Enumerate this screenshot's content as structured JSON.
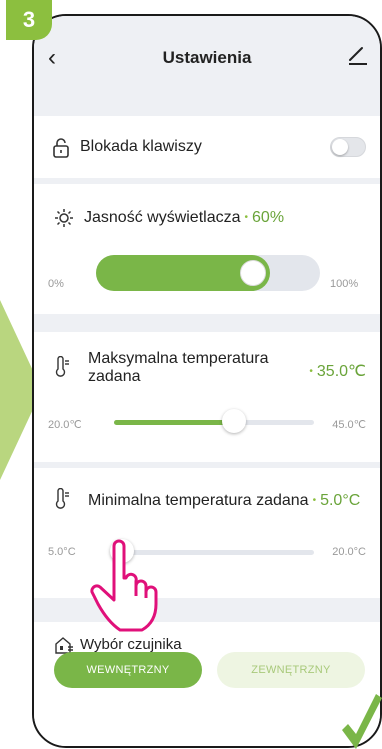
{
  "step_badge": "3",
  "header": {
    "title": "Ustawienia"
  },
  "key_lock": {
    "label": "Blokada klawiszy",
    "enabled": false
  },
  "brightness": {
    "label": "Jasność wyświetlacza",
    "value": "60%",
    "level": 0.6,
    "min": "0%",
    "max": "100%"
  },
  "max_temp": {
    "label_line1": "Maksymalna temperatura",
    "label_line2": "zadana",
    "value": "35.0℃",
    "min": "20.0℃",
    "max": "45.0℃",
    "level": 0.6
  },
  "min_temp": {
    "label": "Minimalna temperatura zadana",
    "value": "5.0°C",
    "min": "5.0°C",
    "max": "20.0°C",
    "level": 0.0
  },
  "sensor": {
    "label": "Wybór czujnika",
    "options": [
      "WEWNĘTRZNY",
      "ZEWNĘTRZNY"
    ],
    "selected": "WEWNĘTRZNY"
  },
  "colors": {
    "accent": "#7ab648",
    "badge": "#8cbf3f",
    "hand": "#e0107a"
  }
}
